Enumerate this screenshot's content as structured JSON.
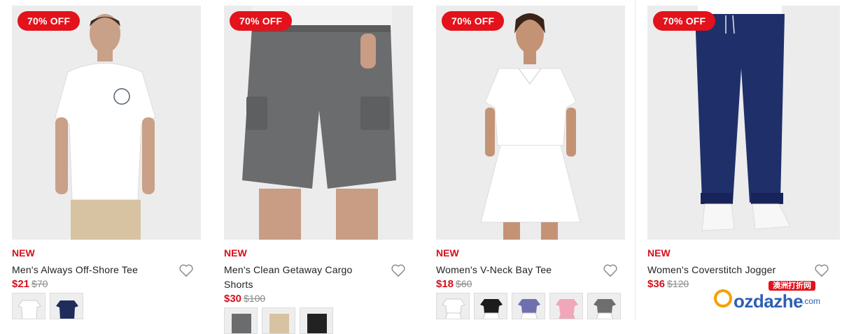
{
  "products": [
    {
      "badge": "70% OFF",
      "tag": "NEW",
      "name": "Men's Always Off-Shore Tee",
      "price": "$21",
      "was": "$70",
      "swatches": [
        "white-tee",
        "navy-tee"
      ]
    },
    {
      "badge": "70% OFF",
      "tag": "NEW",
      "name": "Men's Clean Getaway Cargo Shorts",
      "price": "$30",
      "was": "$100",
      "swatches": [
        "grey-shorts",
        "beige-shorts",
        "black-shorts"
      ]
    },
    {
      "badge": "70% OFF",
      "tag": "NEW",
      "name": "Women's V-Neck Bay Tee",
      "price": "$18",
      "was": "$60",
      "swatches": [
        "white-tee",
        "black-tee",
        "purple-tee",
        "pink-tee",
        "grey-tee"
      ]
    },
    {
      "badge": "70% OFF",
      "tag": "NEW",
      "name": "Women's Coverstitch Jogger",
      "price": "$36",
      "was": "$120",
      "swatches": []
    }
  ],
  "watermark": {
    "chinese": "澳洲打折网",
    "word": "ozdazhe",
    "domain": ".com"
  },
  "colors": {
    "accent": "#e3121b",
    "sale_text": "#d6101a",
    "image_bg": "#ececec",
    "watermark_blue": "#2f5fb3",
    "watermark_orange": "#f2a200"
  }
}
